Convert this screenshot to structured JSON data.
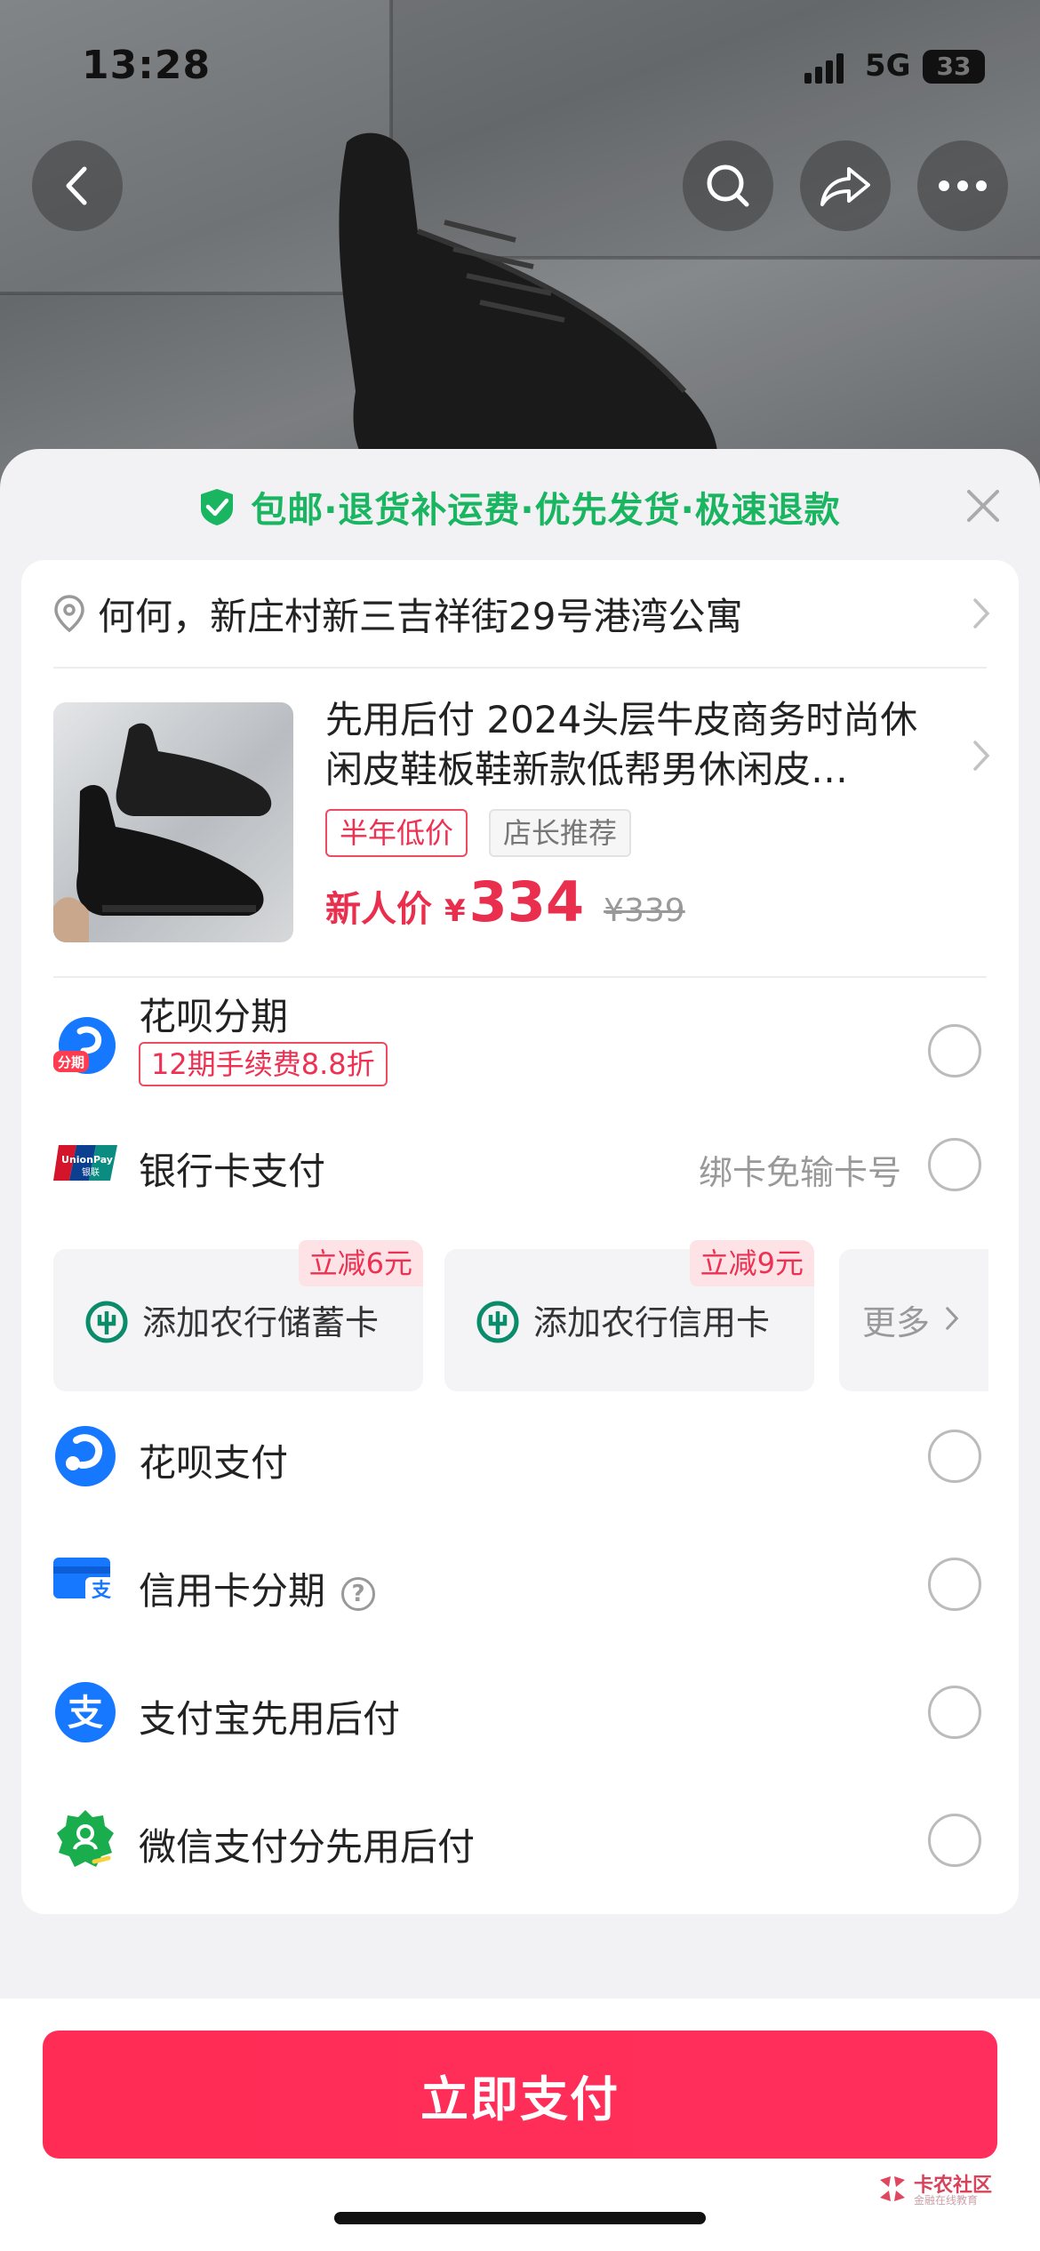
{
  "status_bar": {
    "time": "13:28",
    "network": "5G",
    "battery": "33"
  },
  "banner": {
    "text": "包邮·退货补运费·优先发货·极速退款"
  },
  "address": {
    "text": "何何，新庄村新三吉祥街29号港湾公寓"
  },
  "product": {
    "title": "先用后付 2024头层牛皮商务时尚休闲皮鞋板鞋新款低帮男休闲皮…",
    "tags": [
      "半年低价",
      "店长推荐"
    ],
    "price_label": "新人价",
    "currency": "¥",
    "price": "334",
    "original_price": "¥339"
  },
  "payments": {
    "huabei_installment": {
      "label": "花呗分期",
      "badge": "12期手续费8.8折",
      "icon": "huabei-installment-icon"
    },
    "bank_card": {
      "label": "银行卡支付",
      "hint": "绑卡免输卡号",
      "icon": "unionpay-icon"
    },
    "bank_options": [
      {
        "label": "添加农行储蓄卡",
        "promo": "立减6元",
        "icon": "abc-bank-icon"
      },
      {
        "label": "添加农行信用卡",
        "promo": "立减9元",
        "icon": "abc-bank-icon"
      }
    ],
    "more_label": "更多",
    "huabei_pay": {
      "label": "花呗支付",
      "icon": "huabei-icon"
    },
    "credit_installment": {
      "label": "信用卡分期",
      "help": "?",
      "icon": "credit-card-icon"
    },
    "alipay_later": {
      "label": "支付宝先用后付",
      "icon": "alipay-icon"
    },
    "wechat_later": {
      "label": "微信支付分先用后付",
      "icon": "wechat-score-icon"
    }
  },
  "pay_button": {
    "label": "立即支付"
  },
  "watermark": {
    "title": "卡农社区",
    "subtitle": "金融在线教育"
  },
  "colors": {
    "accent": "#ff2d55",
    "price": "#ea2e4d",
    "green": "#19b561"
  }
}
